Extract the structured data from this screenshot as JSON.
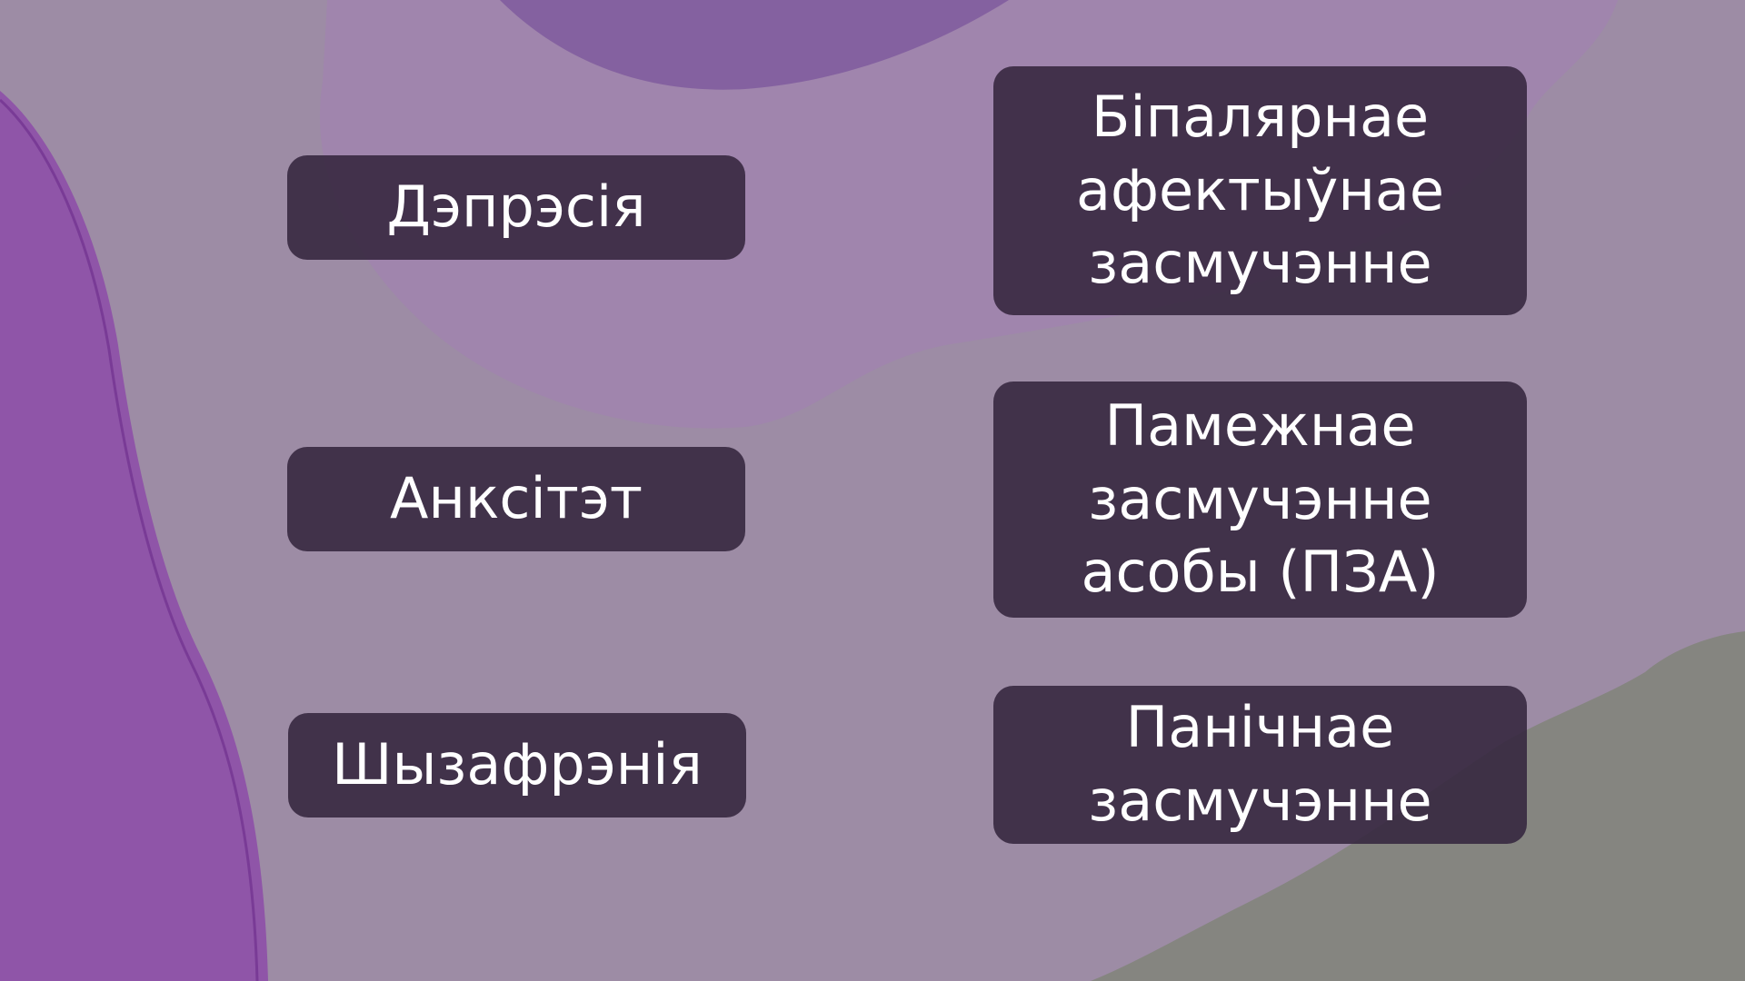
{
  "slide": {
    "left_cards": [
      {
        "label": "Дэпрэсія"
      },
      {
        "label": "Анксітэт"
      },
      {
        "label": "Шызафрэнія"
      }
    ],
    "right_cards": [
      {
        "label": "Біпалярнае\nафектыўнае\nзасмучэнне"
      },
      {
        "label": "Памежнае\nзасмучэнне\nасобы (ПЗА)"
      },
      {
        "label": "Панічнае\nзасмучэнне"
      }
    ]
  },
  "colors": {
    "background": "#9d8ca5",
    "card": "#34263e",
    "text": "#ffffff",
    "purple_shape": "#8a5fa8",
    "left_stripe": "#8e4fa8",
    "grey_corner": "#858580"
  }
}
